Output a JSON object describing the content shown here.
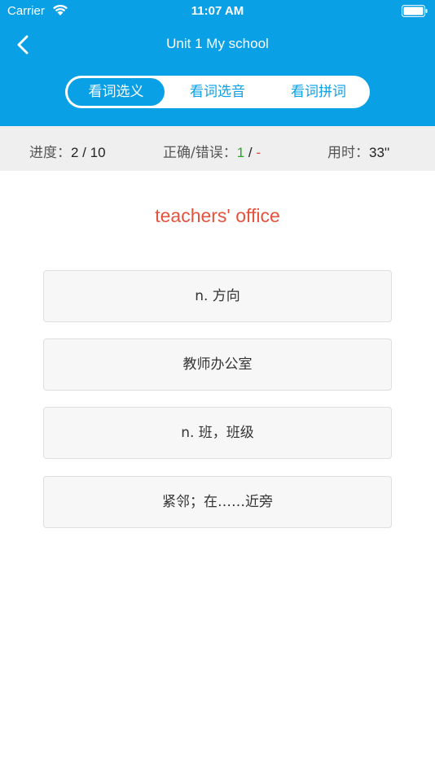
{
  "status_bar": {
    "carrier": "Carrier",
    "time": "11:07 AM"
  },
  "nav": {
    "title": "Unit 1 My school"
  },
  "tabs": [
    {
      "label": "看词选义",
      "active": true
    },
    {
      "label": "看词选音",
      "active": false
    },
    {
      "label": "看词拼词",
      "active": false
    }
  ],
  "stats": {
    "progress_label": "进度：",
    "progress_value": "2 / 10",
    "correct_label": "正确/错误：",
    "correct_count": "1",
    "separator": " / ",
    "wrong_count": "-",
    "time_label": "用时：",
    "time_value": "33''"
  },
  "question": {
    "word": "teachers' office"
  },
  "options": [
    "n. 方向",
    "教师办公室",
    "n. 班，班级",
    "紧邻；在……近旁"
  ],
  "colors": {
    "primary": "#0aa0e6",
    "word": "#e5533d",
    "correct": "#2aa52a",
    "wrong": "#e8463a"
  }
}
